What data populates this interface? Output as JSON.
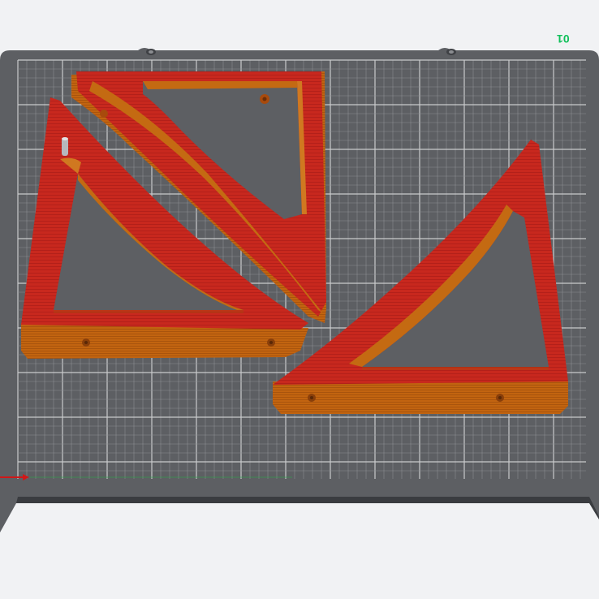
{
  "viewport": {
    "background": "#f1f2f4",
    "plate_color": "#5d5f63",
    "plate_edge_color": "#3f4145",
    "grid_major_color": "#c9cacc",
    "grid_minor_color": "#8b8d91",
    "filament_top_color": "#c8281e",
    "filament_side_color": "#b8620f",
    "filament_shadow_color": "#8a3f0a",
    "x_axis_color": "#d01818",
    "y_axis_color": "#2aa84a"
  },
  "plate": {
    "label": "01"
  },
  "objects": [
    {
      "name": "shelf-bracket",
      "kind": "triangular-bracket"
    },
    {
      "name": "shelf-bracket",
      "kind": "triangular-bracket"
    },
    {
      "name": "shelf-bracket",
      "kind": "triangular-bracket"
    }
  ],
  "icons": [
    "x-axis-arrow-icon",
    "plate-clip-icon"
  ]
}
